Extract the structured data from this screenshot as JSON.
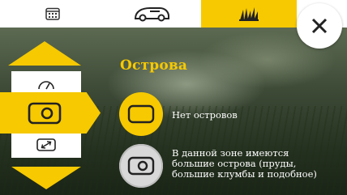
{
  "tabs": [
    {
      "name": "calendar",
      "icon": "calendar-icon",
      "active": false
    },
    {
      "name": "mower",
      "icon": "robot-mower-icon",
      "active": false
    },
    {
      "name": "grass",
      "icon": "grass-icon",
      "active": true
    }
  ],
  "close_icon": "close-icon",
  "modes": {
    "items": [
      "gauge-icon",
      "island-icon",
      "expand-icon"
    ],
    "selected": "island-icon"
  },
  "screen": {
    "title": "Острова"
  },
  "options": [
    {
      "icon": "no-island-icon",
      "label": "Нет островов",
      "selected": true
    },
    {
      "icon": "island-icon",
      "label_lines": [
        "В данной зоне имеются",
        "большие острова (пруды,",
        "большие клумбы и подобное)"
      ],
      "selected": false
    }
  ],
  "colors": {
    "accent": "#f6c900",
    "text": "#ffffff",
    "tab_bg": "#ffffff"
  }
}
